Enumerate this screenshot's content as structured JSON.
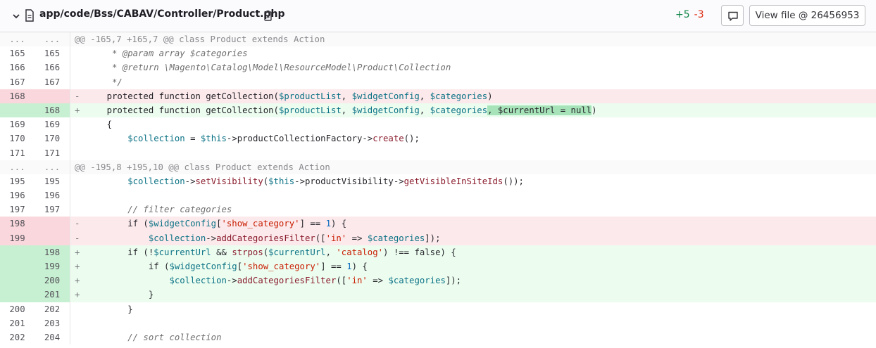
{
  "header": {
    "file_path": "app/code/Bss/CABAV/Controller/Product.php",
    "additions": "+5",
    "deletions": "-3",
    "view_file_label": "View file @ 26456953",
    "icons": [
      "chevron-down-icon",
      "file-icon",
      "copy-icon",
      "comment-icon"
    ]
  },
  "diff": {
    "hunk1": {
      "old": "...",
      "new": "...",
      "text": "@@ -165,7 +165,7 @@ class Product extends Action"
    },
    "hunk2": {
      "old": "...",
      "new": "...",
      "text": "@@ -195,8 +195,10 @@ class Product extends Action"
    },
    "line_numbers": {
      "r1": [
        "165",
        "165"
      ],
      "r2": [
        "166",
        "166"
      ],
      "r3": [
        "167",
        "167"
      ],
      "r4": [
        "168",
        ""
      ],
      "r5": [
        "",
        "168"
      ],
      "r6": [
        "169",
        "169"
      ],
      "r7": [
        "170",
        "170"
      ],
      "r8": [
        "171",
        "171"
      ],
      "r10": [
        "195",
        "195"
      ],
      "r11": [
        "196",
        "196"
      ],
      "r12": [
        "197",
        "197"
      ],
      "r13": [
        "198",
        ""
      ],
      "r14": [
        "199",
        ""
      ],
      "r15": [
        "",
        "198"
      ],
      "r16": [
        "",
        "199"
      ],
      "r17": [
        "",
        "200"
      ],
      "r18": [
        "",
        "201"
      ],
      "r19": [
        "200",
        "202"
      ],
      "r20": [
        "201",
        "203"
      ],
      "r21": [
        "202",
        "204"
      ]
    },
    "code": {
      "r1": "     * @param array $categories",
      "r2": "     * @return \\Magento\\Catalog\\Model\\ResourceModel\\Product\\Collection",
      "r3": "     */",
      "r4a": "    protected function getCollection(",
      "r4b": "$productList",
      "r4c": ", ",
      "r4d": "$widgetConfig",
      "r4e": "$categories",
      "r4f": ")",
      "r5hl": ", $currentUrl = null",
      "r6": "    {",
      "r7a": "        $collection",
      "r7b": " = ",
      "r7c": "$this",
      "r7d": "->productCollectionFactory->",
      "r7e": "create",
      "r7f": "();",
      "r10a": "        $collection",
      "r10b": "->",
      "r10c": "setVisibility",
      "r10d": "(",
      "r10e": "$this",
      "r10f": "->productVisibility->",
      "r10g": "getVisibleInSiteIds",
      "r10h": "());",
      "r12": "        // filter categories",
      "r13a": "        if (",
      "r13b": "$widgetConfig",
      "r13c": "[",
      "r13d": "'show_category'",
      "r13e": "] == ",
      "r13f": "1",
      "r13g": ") {",
      "r14a": "            $collection",
      "r14b": "->",
      "r14c": "addCategoriesFilter",
      "r14d": "([",
      "r14e": "'in'",
      "r14f": " => ",
      "r14g": "$categories",
      "r14h": "]);",
      "r15a": "        if (!",
      "r15b": "$currentUrl",
      "r15c": " && ",
      "r15d": "strpos",
      "r15e": "(",
      "r15f": "$currentUrl",
      "r15g": ", ",
      "r15h": "'catalog'",
      "r15i": ") !== false) {",
      "r16a": "            if (",
      "r17a": "                $collection",
      "r18": "            }",
      "r19": "        }",
      "r21": "        // sort collection"
    },
    "signs": {
      "minus": "-",
      "plus": "+"
    }
  }
}
